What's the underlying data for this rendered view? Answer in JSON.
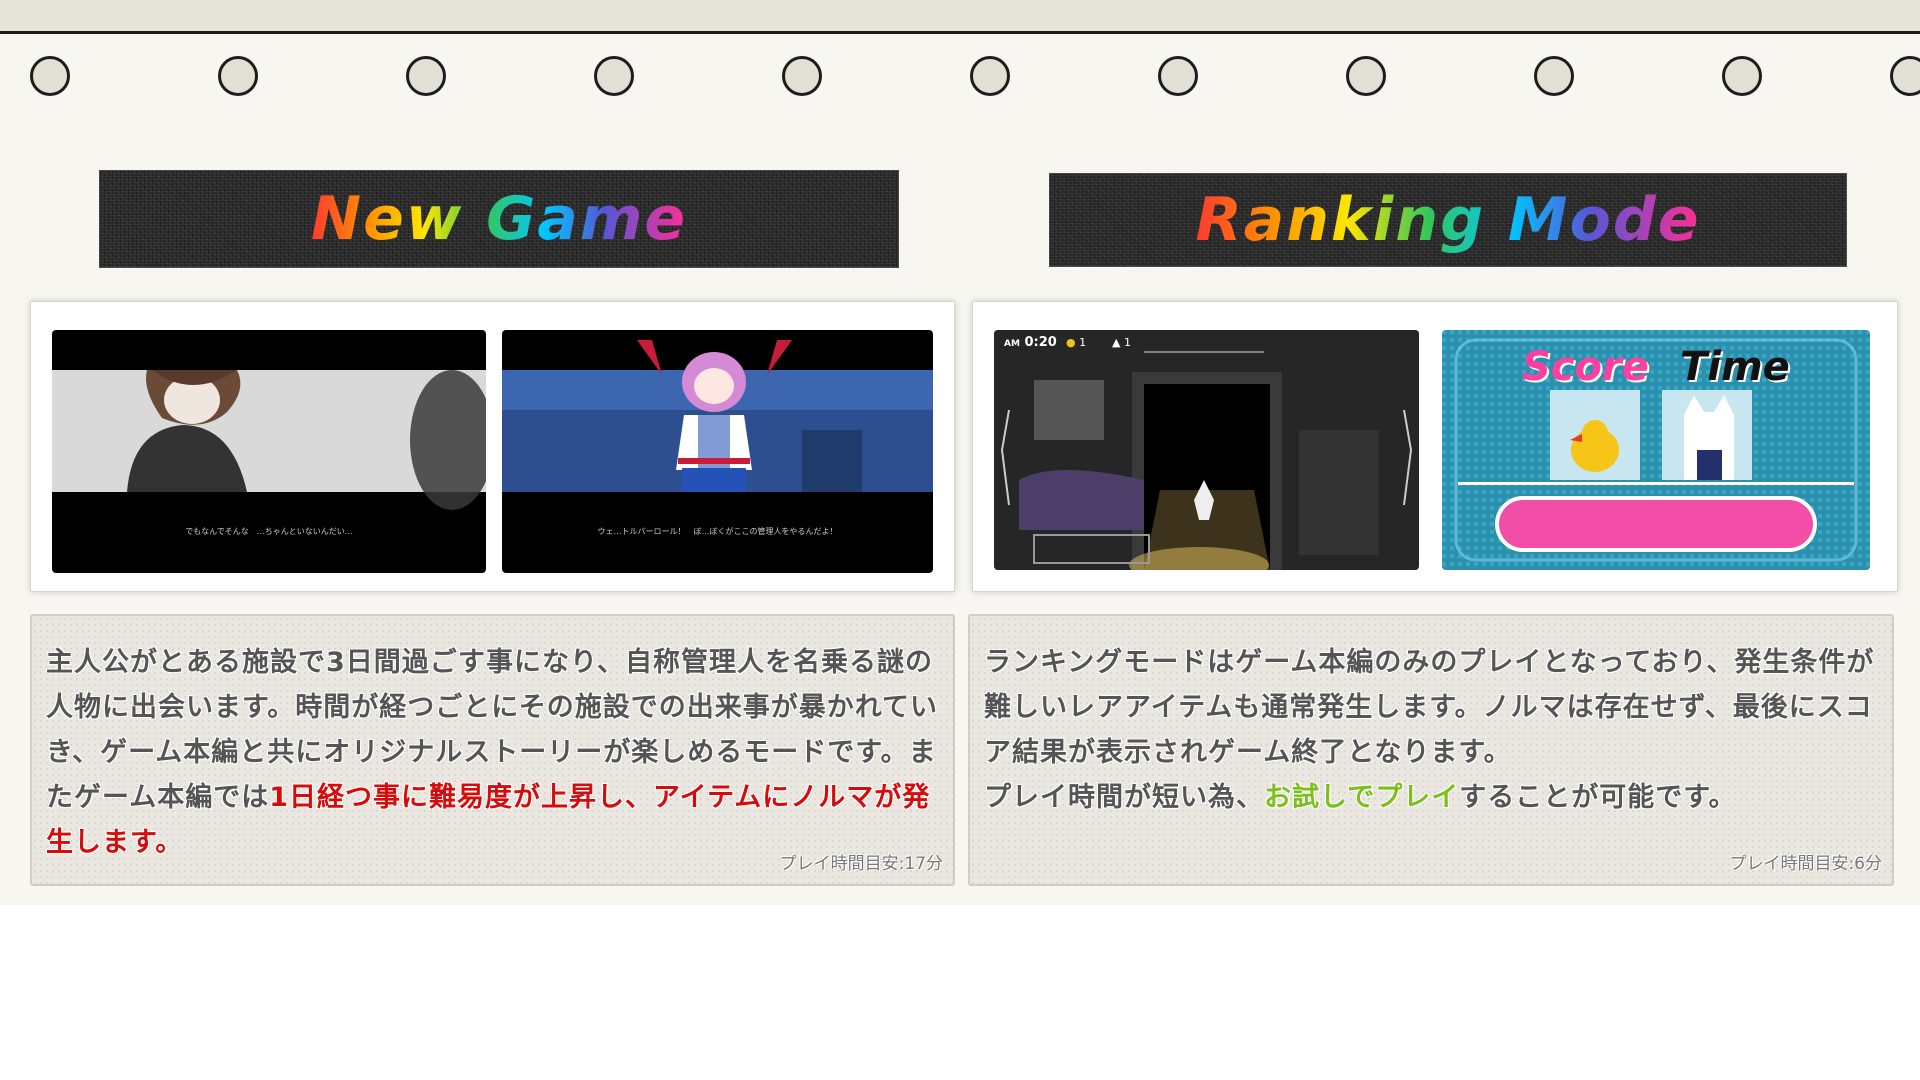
{
  "new_game": {
    "title": "New Game",
    "screenshot_1": {
      "dialogue": "でもなんでそんな　…ちゃんといないんだい…"
    },
    "screenshot_2": {
      "dialogue": "ウェ…トルバーロール！　ぼ…ぼくがここの管理人をやるんだよ！"
    },
    "description_plain_1": "主人公がとある施設で3日間過ごす事になり、自称管理人を名乗る謎の人物に出会います。時間が経つごとにその施設での出来事が暴かれていき、ゲーム本編と共にオリジナルストーリーが楽しめるモードです。またゲーム本編では",
    "description_highlight": "1日経つ事に難易度が上昇し、アイテムにノルマが発生します。",
    "play_time": "プレイ時間目安:17分"
  },
  "ranking_mode": {
    "title": "Ranking Mode",
    "screenshot_1": {
      "time": "0:20",
      "am_label": "AM",
      "ducks": "1",
      "cats": "1"
    },
    "screenshot_2": {
      "score_label": "Score",
      "time_label": "Time"
    },
    "description_plain_1": "ランキングモードはゲーム本編のみのプレイとなっており、発生条件が難しいレアアイテムも通常発生します。ノルマは存在せず、最後にスコア結果が表示されゲーム終了となります。",
    "description_plain_2": "プレイ時間が短い為、",
    "description_highlight": "お試しでプレイ",
    "description_plain_3": "することが可能です。",
    "play_time": "プレイ時間目安:6分"
  },
  "colors": {
    "accent_red": "#d60b0b",
    "accent_green": "#7bbf1a",
    "page_bg": "#f7f6f0"
  }
}
